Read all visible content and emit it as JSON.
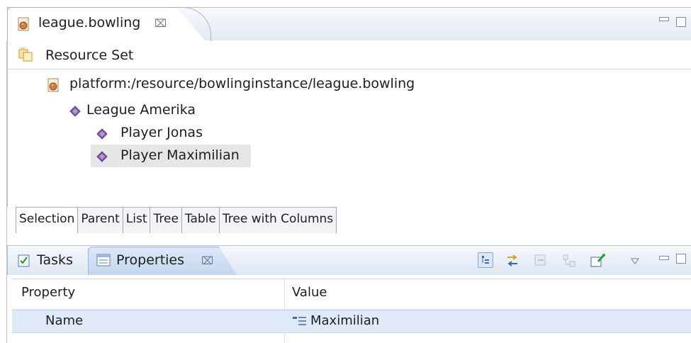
{
  "editor": {
    "tab_title": "league.bowling",
    "close_glyph": "⌧",
    "resource_set_label": "Resource Set",
    "tree": [
      {
        "label": "platform:/resource/bowlinginstance/league.bowling",
        "icon": "bowling-file-icon"
      },
      {
        "label": "League Amerika",
        "icon": "diamond-icon"
      },
      {
        "label": "Player Jonas",
        "icon": "diamond-icon"
      },
      {
        "label": "Player Maximilian",
        "icon": "diamond-icon",
        "selected": true
      }
    ],
    "bottom_tabs": [
      "Selection",
      "Parent",
      "List",
      "Tree",
      "Table",
      "Tree with Columns"
    ]
  },
  "view": {
    "tabs": [
      {
        "label": "Tasks",
        "icon": "tasks-icon"
      },
      {
        "label": "Properties",
        "icon": "properties-icon",
        "active": true
      }
    ],
    "close_glyph": "⌧",
    "toolbar_icons": [
      "show-categories-icon",
      "show-advanced-icon",
      "restore-default-icon",
      "filter-icon",
      "pin-icon",
      "view-menu-icon"
    ],
    "table": {
      "columns": [
        "Property",
        "Value"
      ],
      "rows": [
        {
          "property": "Name",
          "value": "Maximilian"
        }
      ]
    }
  },
  "colors": {
    "accent_blue": "#c4d7ee",
    "selection_gray": "#e6e6e6",
    "row_highlight": "#dfe9f7",
    "diamond_purple": "#7e5ea4"
  }
}
